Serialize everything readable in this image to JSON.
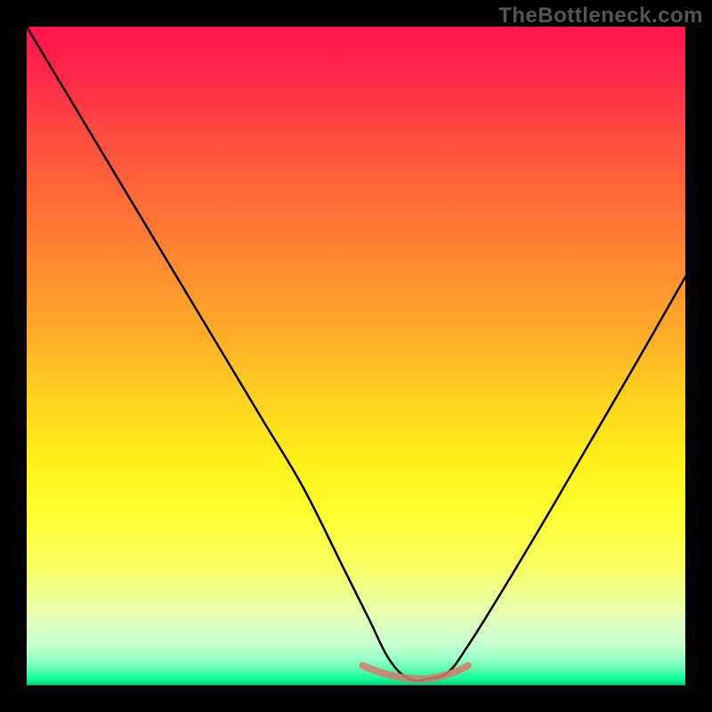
{
  "meta": {
    "watermark_text": "TheBottleneck.com"
  },
  "chart_data": {
    "type": "line",
    "title": "",
    "xlabel": "",
    "ylabel": "",
    "xlim": [
      0,
      100
    ],
    "ylim": [
      0,
      100
    ],
    "background_gradient": {
      "top_color": "#ff1450",
      "mid_upper_color": "#ffaa28",
      "mid_lower_color": "#ffff30",
      "bottom_color": "#05c070",
      "description": "vertical rainbow gradient from red (top) through orange/yellow to green (bottom) representing bottleneck severity; green = optimal, red = heavy bottleneck"
    },
    "series": [
      {
        "name": "bottleneck-curve",
        "description": "V-shaped bottleneck percentage curve; left branch descends steeply from top-left, flattens near bottom around x≈55-65, then rises to the right.",
        "color": "#000000",
        "x": [
          0,
          6,
          12,
          18,
          24,
          30,
          36,
          42,
          48,
          52,
          55,
          58,
          61,
          64,
          67,
          72,
          78,
          85,
          92,
          100
        ],
        "y": [
          100,
          90,
          80,
          70,
          60,
          50,
          40,
          30,
          18,
          10,
          4,
          1,
          1,
          2,
          6,
          14,
          24,
          36,
          48,
          62
        ]
      },
      {
        "name": "optimal-band-marker",
        "description": "faint red dashed/soft line segment marking the flat optimal region at the bottom of the V",
        "color": "#d9786d",
        "x": [
          51,
          53,
          55,
          57,
          59,
          61,
          63,
          65,
          67
        ],
        "y": [
          3,
          2.2,
          1.6,
          1.2,
          1.0,
          1.0,
          1.4,
          2.0,
          3
        ]
      }
    ],
    "annotations": []
  }
}
